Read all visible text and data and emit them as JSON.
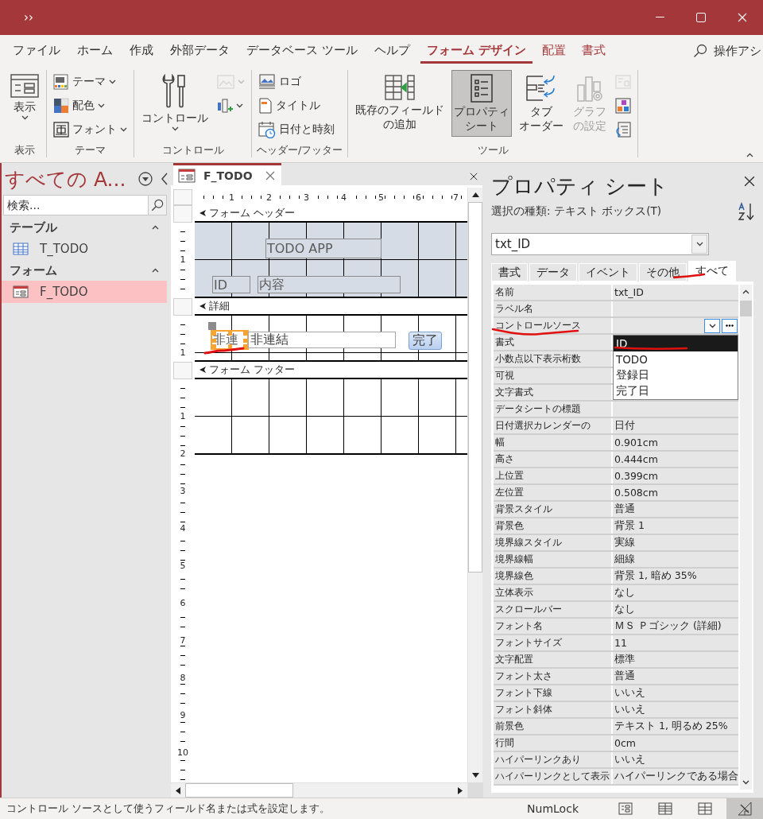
{
  "title_bar": {
    "quick_access": "››"
  },
  "ribbon_tabs": [
    {
      "label": "ファイル",
      "selected": false,
      "kind": "standard"
    },
    {
      "label": "ホーム",
      "selected": false,
      "kind": "standard"
    },
    {
      "label": "作成",
      "selected": false,
      "kind": "standard"
    },
    {
      "label": "外部データ",
      "selected": false,
      "kind": "standard"
    },
    {
      "label": "データベース ツール",
      "selected": false,
      "kind": "standard"
    },
    {
      "label": "ヘルプ",
      "selected": false,
      "kind": "standard"
    },
    {
      "label": "フォーム デザイン",
      "selected": true,
      "kind": "contextual"
    },
    {
      "label": "配置",
      "selected": false,
      "kind": "contextual"
    },
    {
      "label": "書式",
      "selected": false,
      "kind": "contextual"
    }
  ],
  "tell_me": "操作アシ",
  "ribbon_groups": [
    {
      "label": "表示",
      "buttons": [
        {
          "kind": "large",
          "label": "表示",
          "dropdown": true,
          "selected": false,
          "disabled": false
        }
      ]
    },
    {
      "label": "テーマ",
      "buttons": [
        {
          "kind": "small",
          "label": "テーマ",
          "dropdown": true,
          "selected": false,
          "disabled": false
        },
        {
          "kind": "small",
          "label": "配色",
          "dropdown": true,
          "selected": false,
          "disabled": false
        },
        {
          "kind": "small",
          "label": "フォント",
          "dropdown": true,
          "selected": false,
          "disabled": false
        }
      ]
    },
    {
      "label": "コントロール",
      "buttons": [
        {
          "kind": "large",
          "label": "コントロール",
          "dropdown": true,
          "selected": false,
          "disabled": false
        },
        {
          "kind": "icon",
          "dropdown": true,
          "selected": false,
          "disabled": true
        },
        {
          "kind": "icon",
          "dropdown": true,
          "selected": false,
          "disabled": false
        }
      ]
    },
    {
      "label": "ヘッダー/フッター",
      "buttons": [
        {
          "kind": "small",
          "label": "ロゴ",
          "dropdown": false,
          "selected": false,
          "disabled": false
        },
        {
          "kind": "small",
          "label": "タイトル",
          "dropdown": false,
          "selected": false,
          "disabled": false
        },
        {
          "kind": "small",
          "label": "日付と時刻",
          "dropdown": false,
          "selected": false,
          "disabled": false
        }
      ]
    },
    {
      "label": "ツール",
      "buttons": [
        {
          "kind": "large",
          "lines": [
            "既存のフィールド",
            "の追加"
          ],
          "dropdown": false,
          "selected": false,
          "disabled": false
        },
        {
          "kind": "large",
          "lines": [
            "プロパティ",
            "シート"
          ],
          "dropdown": false,
          "selected": true,
          "disabled": false
        },
        {
          "kind": "large",
          "lines": [
            "タブ",
            "オーダー"
          ],
          "dropdown": false,
          "selected": false,
          "disabled": false
        },
        {
          "kind": "large",
          "lines": [
            "グラフ",
            "の設定"
          ],
          "dropdown": false,
          "selected": false,
          "disabled": true
        },
        {
          "kind": "icon",
          "dropdown": false,
          "selected": false,
          "disabled": true
        },
        {
          "kind": "icon",
          "dropdown": false,
          "selected": false,
          "disabled": false
        },
        {
          "kind": "icon",
          "dropdown": false,
          "selected": false,
          "disabled": false
        }
      ]
    }
  ],
  "nav_pane": {
    "title": "すべての A...",
    "search": {
      "placeholder": "検索..."
    },
    "groups": [
      {
        "label": "テーブル",
        "expanded": true,
        "items": [
          {
            "label": "T_TODO",
            "kind": "table",
            "selected": false
          }
        ]
      },
      {
        "label": "フォーム",
        "expanded": true,
        "items": [
          {
            "label": "F_TODO",
            "kind": "form",
            "selected": true
          }
        ]
      }
    ]
  },
  "document": {
    "tab": {
      "label": "F_TODO",
      "selected": true
    },
    "ruler": [
      "1",
      "2",
      "3",
      "4",
      "5",
      "6",
      "7"
    ],
    "sections": [
      {
        "kind": "header",
        "title": "フォーム ヘッダー",
        "ruler": [
          "1"
        ],
        "controls": [
          {
            "kind": "label",
            "text": "TODO APP",
            "selected": false
          },
          {
            "kind": "label",
            "text": "ID",
            "selected": false
          },
          {
            "kind": "label",
            "text": "内容",
            "selected": false
          }
        ]
      },
      {
        "kind": "detail",
        "title": "詳細",
        "ruler": [
          "1"
        ],
        "controls": [
          {
            "kind": "label",
            "text": "非連",
            "selected": true
          },
          {
            "kind": "textbox",
            "text": "非連結",
            "selected": false
          },
          {
            "kind": "button",
            "text": "完了",
            "selected": false
          }
        ]
      },
      {
        "kind": "footer",
        "title": "フォーム フッター",
        "ruler": [
          "1",
          "2",
          "3",
          "4",
          "5",
          "6",
          "7",
          "8",
          "9",
          "10"
        ]
      }
    ]
  },
  "property_sheet": {
    "title": "プロパティ シート",
    "selection_type": "選択の種類: テキスト ボックス(T)",
    "object": "txt_ID",
    "tabs": [
      {
        "label": "書式",
        "selected": false
      },
      {
        "label": "データ",
        "selected": false
      },
      {
        "label": "イベント",
        "selected": false
      },
      {
        "label": "その他",
        "selected": false
      },
      {
        "label": "すべて",
        "selected": true
      }
    ],
    "properties": [
      {
        "name": "名前",
        "value": "txt_ID",
        "kind": "text"
      },
      {
        "name": "ラベル名",
        "kind": "text"
      },
      {
        "name": "コントロールソース",
        "kind": "combo"
      },
      {
        "name": "書式",
        "kind": "text"
      },
      {
        "name": "小数点以下表示桁数",
        "kind": "text"
      },
      {
        "name": "可視",
        "kind": "text"
      },
      {
        "name": "文字書式",
        "kind": "text"
      },
      {
        "name": "データシートの標題",
        "kind": "text"
      },
      {
        "name": "日付選択カレンダーの",
        "value": "日付",
        "kind": "text"
      },
      {
        "name": "幅",
        "value": "0.901cm",
        "kind": "text"
      },
      {
        "name": "高さ",
        "value": "0.444cm",
        "kind": "text"
      },
      {
        "name": "上位置",
        "value": "0.399cm",
        "kind": "text"
      },
      {
        "name": "左位置",
        "value": "0.508cm",
        "kind": "text"
      },
      {
        "name": "背景スタイル",
        "value": "普通",
        "kind": "text"
      },
      {
        "name": "背景色",
        "value": "背景 1",
        "kind": "text"
      },
      {
        "name": "境界線スタイル",
        "value": "実線",
        "kind": "text"
      },
      {
        "name": "境界線幅",
        "value": "細線",
        "kind": "text"
      },
      {
        "name": "境界線色",
        "value": "背景 1, 暗め 35%",
        "kind": "text"
      },
      {
        "name": "立体表示",
        "value": "なし",
        "kind": "text"
      },
      {
        "name": "スクロールバー",
        "value": "なし",
        "kind": "text"
      },
      {
        "name": "フォント名",
        "value": "ＭＳ Ｐゴシック (詳細)",
        "kind": "text"
      },
      {
        "name": "フォントサイズ",
        "value": "11",
        "kind": "text"
      },
      {
        "name": "文字配置",
        "value": "標準",
        "kind": "text"
      },
      {
        "name": "フォント太さ",
        "value": "普通",
        "kind": "text"
      },
      {
        "name": "フォント下線",
        "value": "いいえ",
        "kind": "text"
      },
      {
        "name": "フォント斜体",
        "value": "いいえ",
        "kind": "text"
      },
      {
        "name": "前景色",
        "value": "テキスト 1, 明るめ 25%",
        "kind": "text"
      },
      {
        "name": "行間",
        "value": "0cm",
        "kind": "text"
      },
      {
        "name": "ハイパーリンクあり",
        "value": "いいえ",
        "kind": "text"
      },
      {
        "name": "ハイパーリンクとして表示",
        "value": "ハイパーリンクである場合",
        "kind": "text"
      }
    ],
    "dropdown": {
      "items": [
        {
          "label": "ID",
          "selected": true
        },
        {
          "label": "TODO",
          "selected": false
        },
        {
          "label": "登録日",
          "selected": false
        },
        {
          "label": "完了日",
          "selected": false
        }
      ]
    }
  },
  "status_bar": {
    "message": "コントロール ソースとして使うフィールド名または式を設定します。",
    "numlock": "NumLock",
    "views": [
      {
        "selected": false
      },
      {
        "selected": false
      },
      {
        "selected": false
      },
      {
        "selected": true
      }
    ]
  }
}
